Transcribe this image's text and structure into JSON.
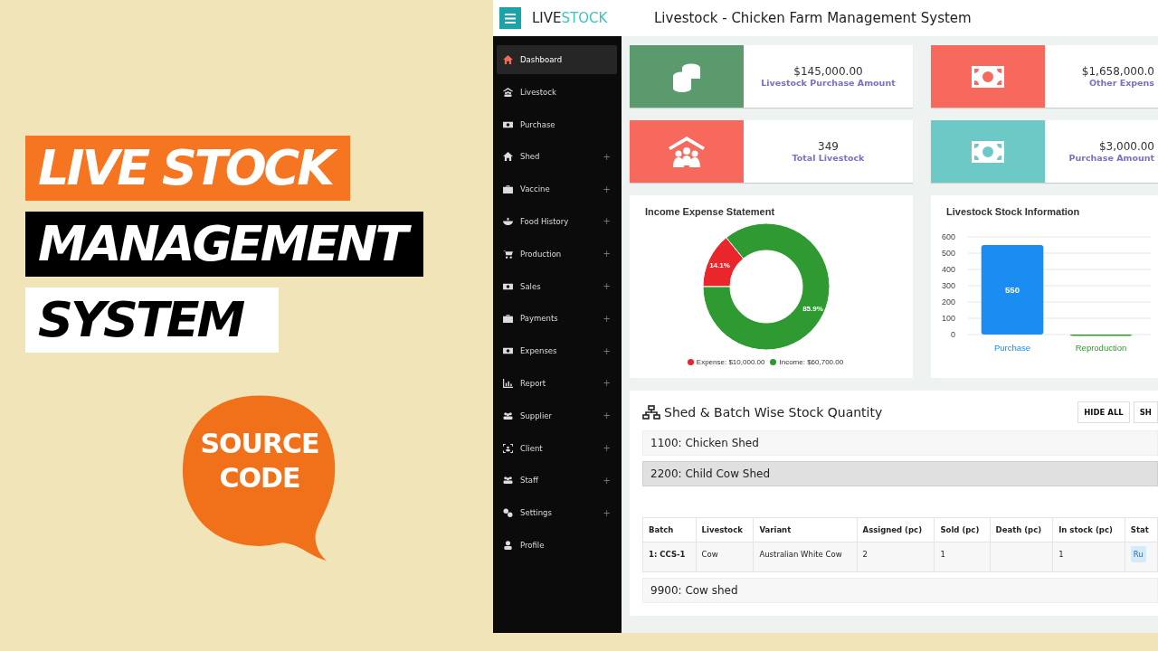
{
  "banner": {
    "lines": [
      {
        "text": "LIVE STOCK",
        "kind": "orange"
      },
      {
        "text": "MANAGEMENT",
        "kind": "black"
      },
      {
        "text": "SYSTEM",
        "kind": "white"
      }
    ],
    "bubble": [
      "SOURCE",
      "CODE"
    ]
  },
  "app": {
    "logo": {
      "first": "LIVE",
      "second": "STOCK"
    },
    "title": "Livestock - Chicken Farm Management System",
    "sidebar": {
      "items": [
        {
          "label": "Dashboard",
          "selected": true,
          "expandable": false
        },
        {
          "label": "Livestock",
          "selected": false,
          "expandable": false
        },
        {
          "label": "Purchase",
          "selected": false,
          "expandable": false
        },
        {
          "label": "Shed",
          "selected": false,
          "expandable": true
        },
        {
          "label": "Vaccine",
          "selected": false,
          "expandable": true
        },
        {
          "label": "Food History",
          "selected": false,
          "expandable": true
        },
        {
          "label": "Production",
          "selected": false,
          "expandable": true
        },
        {
          "label": "Sales",
          "selected": false,
          "expandable": true
        },
        {
          "label": "Payments",
          "selected": false,
          "expandable": true
        },
        {
          "label": "Expenses",
          "selected": false,
          "expandable": true
        },
        {
          "label": "Report",
          "selected": false,
          "expandable": true
        },
        {
          "label": "Supplier",
          "selected": false,
          "expandable": true
        },
        {
          "label": "Client",
          "selected": false,
          "expandable": true
        },
        {
          "label": "Staff",
          "selected": false,
          "expandable": true
        },
        {
          "label": "Settings",
          "selected": false,
          "expandable": true
        },
        {
          "label": "Profile",
          "selected": false,
          "expandable": false
        }
      ],
      "expand_sign": "+"
    },
    "stats": [
      {
        "value": "$145,000.00",
        "label": "Livestock Purchase Amount",
        "color": "#5b9a6c"
      },
      {
        "value": "$1,658,000.0",
        "label": "Other Expens",
        "color": "#f7695c"
      },
      {
        "value": "349",
        "label": "Total Livestock",
        "color": "#f7695c"
      },
      {
        "value": "$3,000.00",
        "label": "Purchase Amount",
        "color": "#6dc9c5"
      }
    ],
    "income_chart": {
      "title": "Income Expense Statement",
      "chart_data": {
        "type": "donut",
        "categories": [
          "Expense",
          "Income"
        ],
        "values": [
          14.1,
          85.9
        ],
        "value_labels": [
          "14.1%",
          "85.9%"
        ]
      },
      "legend_amounts": [
        ": $10,000.00",
        ": $60,700.00"
      ]
    },
    "stock_chart": {
      "title": "Livestock Stock Information",
      "chart_data": {
        "type": "bar",
        "categories": [
          "Purchase",
          "Reproduction"
        ],
        "values": [
          550,
          0
        ],
        "ylim": [
          0,
          600
        ],
        "yticks": [
          0,
          100,
          200,
          300,
          400,
          500,
          600
        ],
        "grid": true,
        "value_labels": [
          "550",
          null
        ]
      }
    },
    "sheds": {
      "title": "Shed & Batch Wise Stock Quantity",
      "buttons": [
        "HIDE ALL",
        "SH"
      ],
      "items": [
        {
          "name": "1100: Chicken Shed",
          "expanded": false
        },
        {
          "name": "2200: Child Cow Shed",
          "expanded": true,
          "table": {
            "columns": [
              "Batch",
              "Livestock",
              "Variant",
              "Assigned (pc)",
              "Sold (pc)",
              "Death (pc)",
              "In stock (pc)",
              "Stat"
            ],
            "rows": [
              {
                "cells": [
                  "1: CCS-1",
                  "Cow",
                  "Australian White Cow",
                  "2",
                  "1",
                  null,
                  "1"
                ],
                "status": "Ru"
              }
            ]
          }
        },
        {
          "name": "9900: Cow shed",
          "expanded": false
        }
      ]
    }
  }
}
